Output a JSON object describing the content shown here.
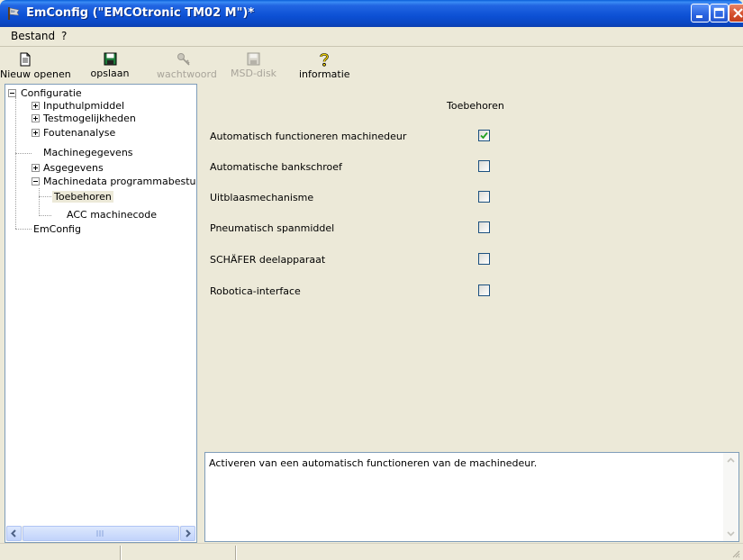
{
  "window": {
    "title": "EmConfig (\"EMCOtronic TM02 M\")*",
    "accent_color": "#0a47c4"
  },
  "menu": {
    "items": [
      {
        "label": "Bestand"
      },
      {
        "label": "?"
      }
    ]
  },
  "toolbar": {
    "new": {
      "label": "Nieuw openen",
      "icon": "document-icon",
      "enabled": true
    },
    "save": {
      "label": "opslaan",
      "icon": "floppy-disk-icon",
      "enabled": true
    },
    "password": {
      "label": "wachtwoord",
      "icon": "key-icon",
      "enabled": false
    },
    "msd": {
      "label": "MSD-disk",
      "icon": "disk-icon",
      "enabled": false
    },
    "info": {
      "label": "informatie",
      "icon": "question-icon",
      "enabled": true
    }
  },
  "tree": {
    "items": [
      {
        "label": "Configuratie",
        "expander": "minus"
      },
      {
        "label": "Inputhulpmiddel",
        "expander": "plus"
      },
      {
        "label": "Testmogelijkheden",
        "expander": "plus"
      },
      {
        "label": "Foutenanalyse",
        "expander": "plus"
      },
      {
        "label": "Machinegegevens",
        "expander": "none"
      },
      {
        "label": "Asgegevens",
        "expander": "plus"
      },
      {
        "label": "Machinedata programmabesturir",
        "expander": "minus"
      },
      {
        "label": "Toebehoren",
        "expander": "none",
        "selected": true
      },
      {
        "label": "ACC machinecode",
        "expander": "none"
      },
      {
        "label": "EmConfig",
        "expander": "none"
      }
    ]
  },
  "main": {
    "section_title": "Toebehoren",
    "options": [
      {
        "label": "Automatisch functioneren machinedeur",
        "checked": true
      },
      {
        "label": "Automatische bankschroef",
        "checked": false
      },
      {
        "label": "Uitblaasmechanisme",
        "checked": false
      },
      {
        "label": "Pneumatisch spanmiddel",
        "checked": false
      },
      {
        "label": "SCHÄFER deelapparaat",
        "checked": false
      },
      {
        "label": "Robotica-interface",
        "checked": false
      }
    ],
    "description": "Activeren van een automatisch functioneren van de machinedeur."
  }
}
